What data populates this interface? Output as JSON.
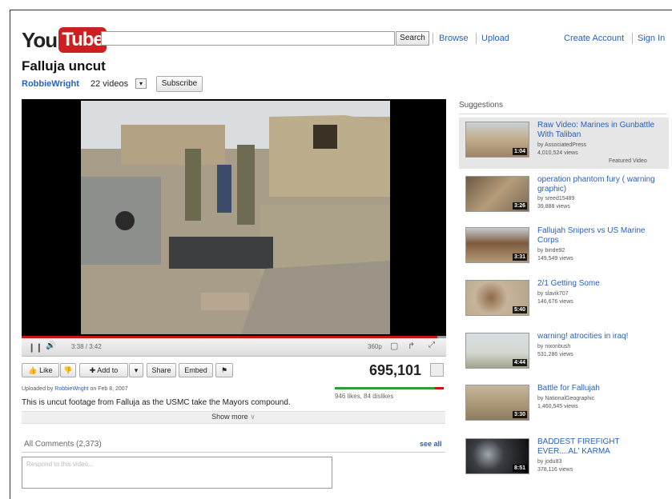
{
  "header": {
    "logo_you": "You",
    "logo_tube": "Tube",
    "search_button": "Search",
    "nav": {
      "browse": "Browse",
      "upload": "Upload",
      "create_account": "Create Account",
      "sign_in": "Sign In"
    }
  },
  "video": {
    "title": "Falluja uncut",
    "channel": "RobbieWright",
    "channel_videos": "22 videos",
    "subscribe_label": "Subscribe",
    "time": "3:38 / 3:42",
    "quality": "360p",
    "progress_fraction": 0.98,
    "views": "695,101",
    "likes_text": "946 likes, 84 dislikes",
    "like_fraction": 0.918,
    "uploaded_prefix": "Uploaded by",
    "uploaded_by": "RobbieWright",
    "uploaded_on": "on Feb 8, 2007",
    "description": "This is uncut footage from Falluja as the USMC take the Mayors compound.",
    "show_more": "Show more"
  },
  "actions": {
    "like": "Like",
    "add_to": "Add to",
    "share": "Share",
    "embed": "Embed"
  },
  "comments": {
    "header": "All Comments (2,373)",
    "see_all": "see all",
    "placeholder": "Respond to this video..."
  },
  "suggestions": {
    "header": "Suggestions",
    "items": [
      {
        "title": "Raw Video: Marines in Gunbattle With Taliban",
        "by": "by AssociatedPress",
        "views": "4,010,524 views",
        "duration": "1:04",
        "featured": "Featured Video"
      },
      {
        "title": "operation phantom fury ( warning graphic)",
        "by": "by sreed15489",
        "views": "39,888 views",
        "duration": "3:26"
      },
      {
        "title": "Fallujah Snipers vs US Marine Corps",
        "by": "by binde92",
        "views": "149,549 views",
        "duration": "3:31"
      },
      {
        "title": "2/1 Getting Some",
        "by": "by slavik707",
        "views": "146,676 views",
        "duration": "5:40"
      },
      {
        "title": "warning! atrocities in iraq!",
        "by": "by nixonbush",
        "views": "531,286 views",
        "duration": "4:44"
      },
      {
        "title": "Battle for Fallujah",
        "by": "by NationalGeographic",
        "views": "1,460,545 views",
        "duration": "3:30"
      },
      {
        "title": "BADDEST FIREFIGHT EVER....AL' KARMA",
        "by": "by jodu83",
        "views": "378,116 views",
        "duration": "8:51"
      }
    ]
  }
}
